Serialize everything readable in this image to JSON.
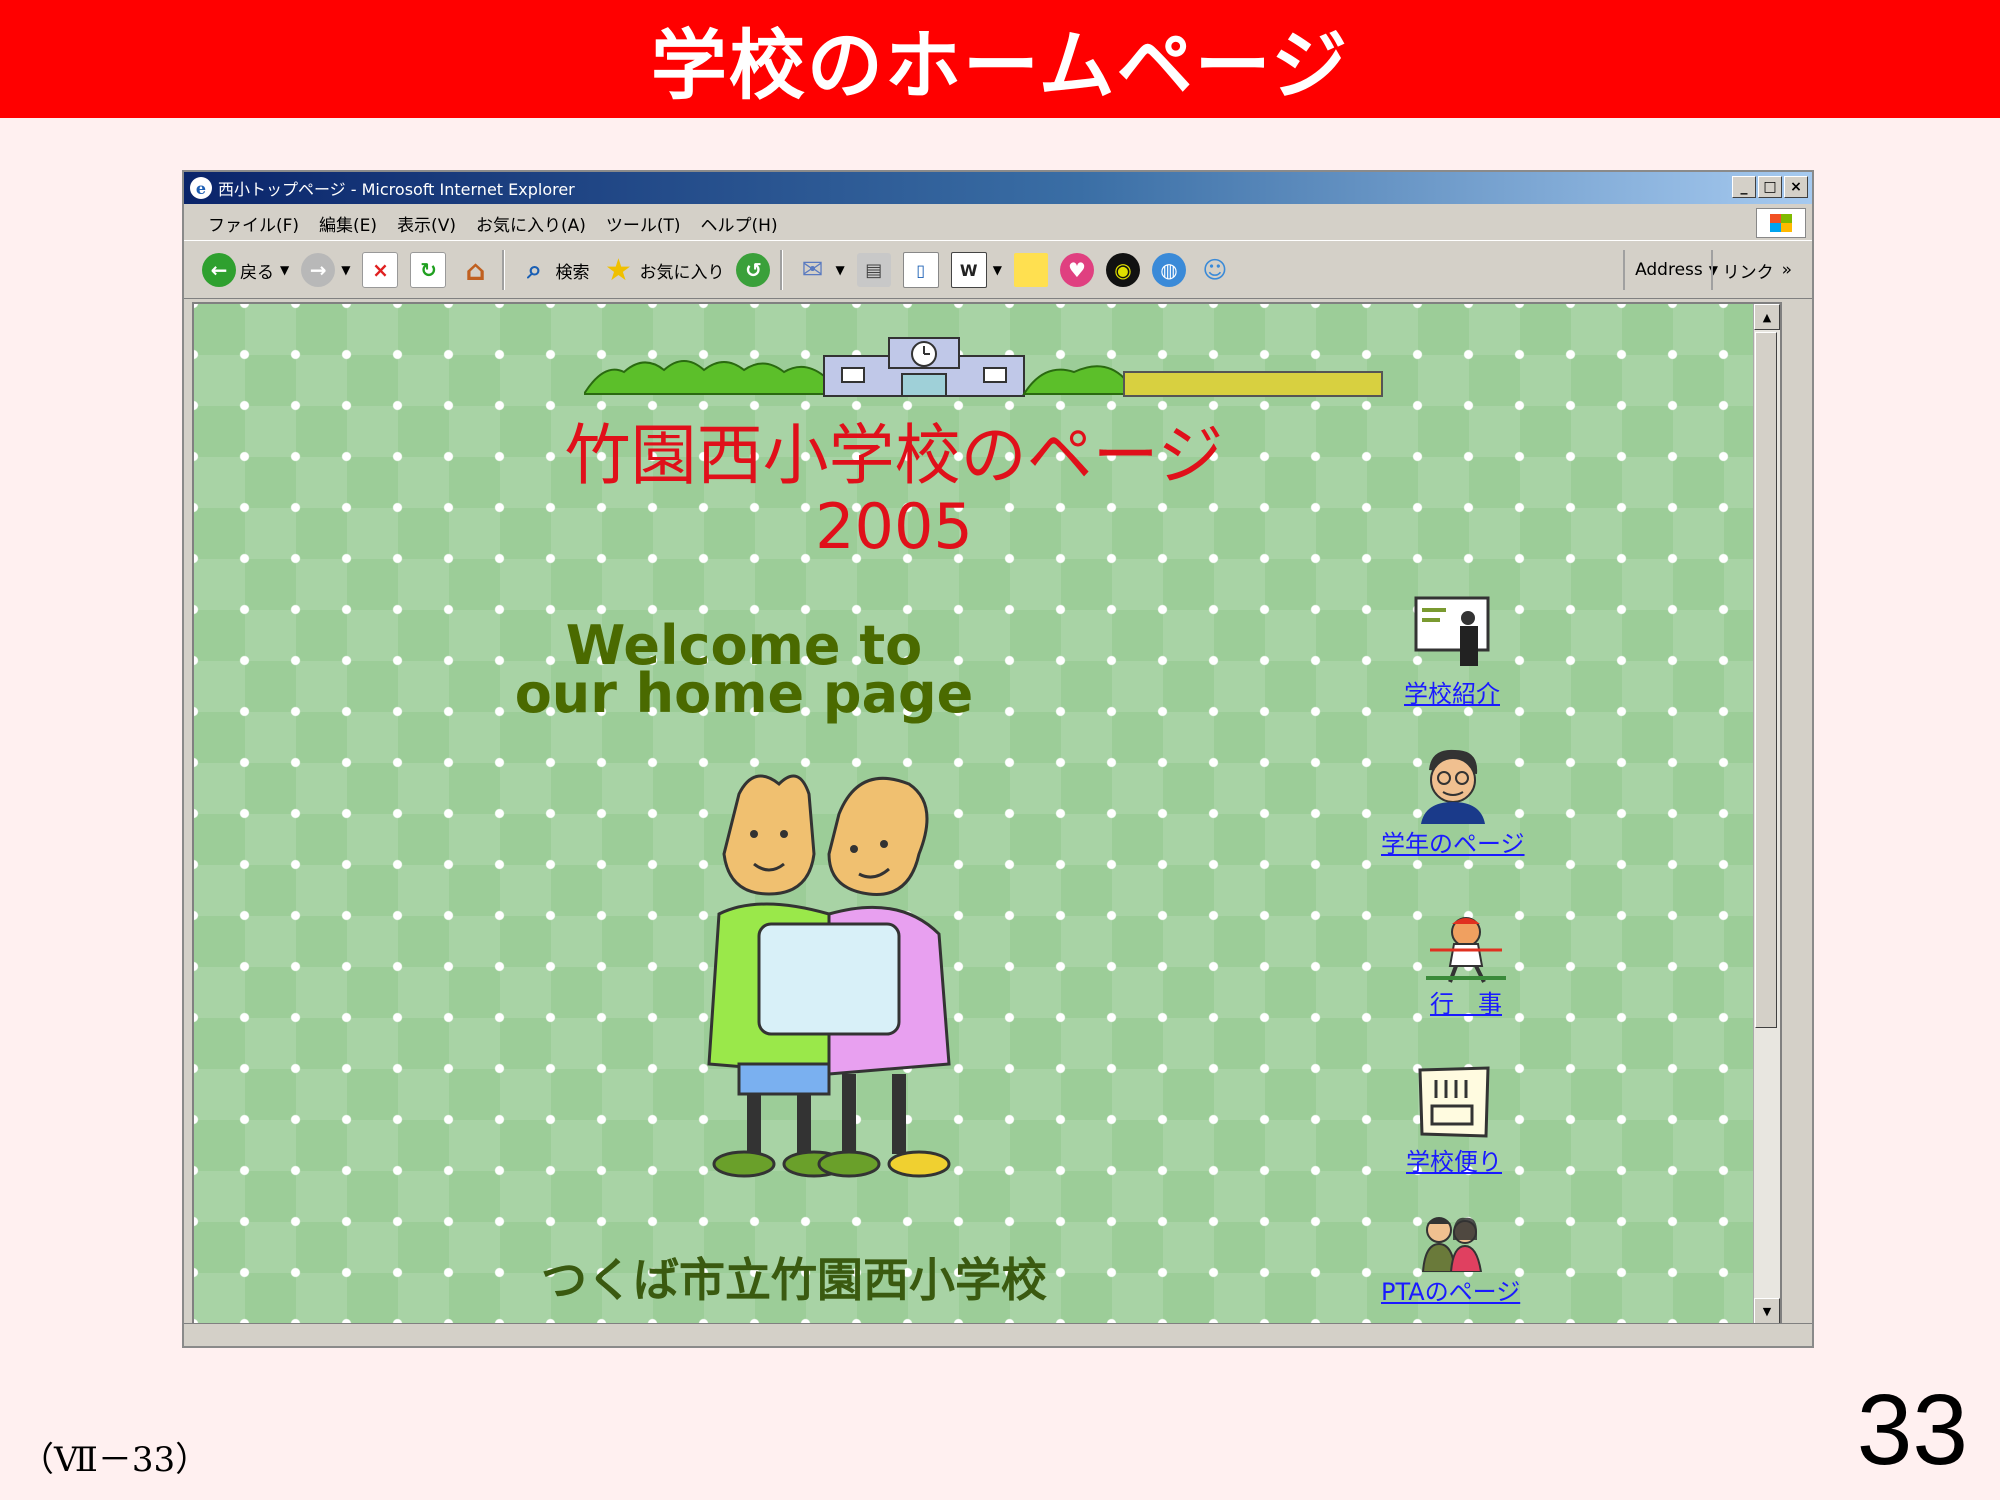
{
  "slide": {
    "title": "学校のホームページ",
    "footer": "（Ⅶ－33）",
    "page_number": "33"
  },
  "browser": {
    "title": "西小トップページ - Microsoft Internet Explorer",
    "window_buttons": [
      "_",
      "□",
      "×"
    ],
    "menu": [
      "ファイル(F)",
      "編集(E)",
      "表示(V)",
      "お気に入り(A)",
      "ツール(T)",
      "ヘルプ(H)"
    ],
    "toolbar": {
      "back_label": "戻る",
      "search_label": "検索",
      "favorites_label": "お気に入り",
      "address_label": "Address",
      "links_label": "リンク",
      "more": "»"
    }
  },
  "page": {
    "title": "竹園西小学校のページ",
    "year": "2005",
    "welcome_line1": "Welcome to",
    "welcome_line2": "our home page",
    "school_name": "つくば市立竹園西小学校",
    "nav_links": [
      "学校紹介",
      "学年のページ",
      "行　事",
      "学校便り",
      "PTAのページ"
    ]
  },
  "colors": {
    "banner": "#ff0000",
    "page_title": "#e0101a",
    "welcome": "#4a6a00",
    "link": "#1a1aff",
    "background": "#9ccd98"
  }
}
